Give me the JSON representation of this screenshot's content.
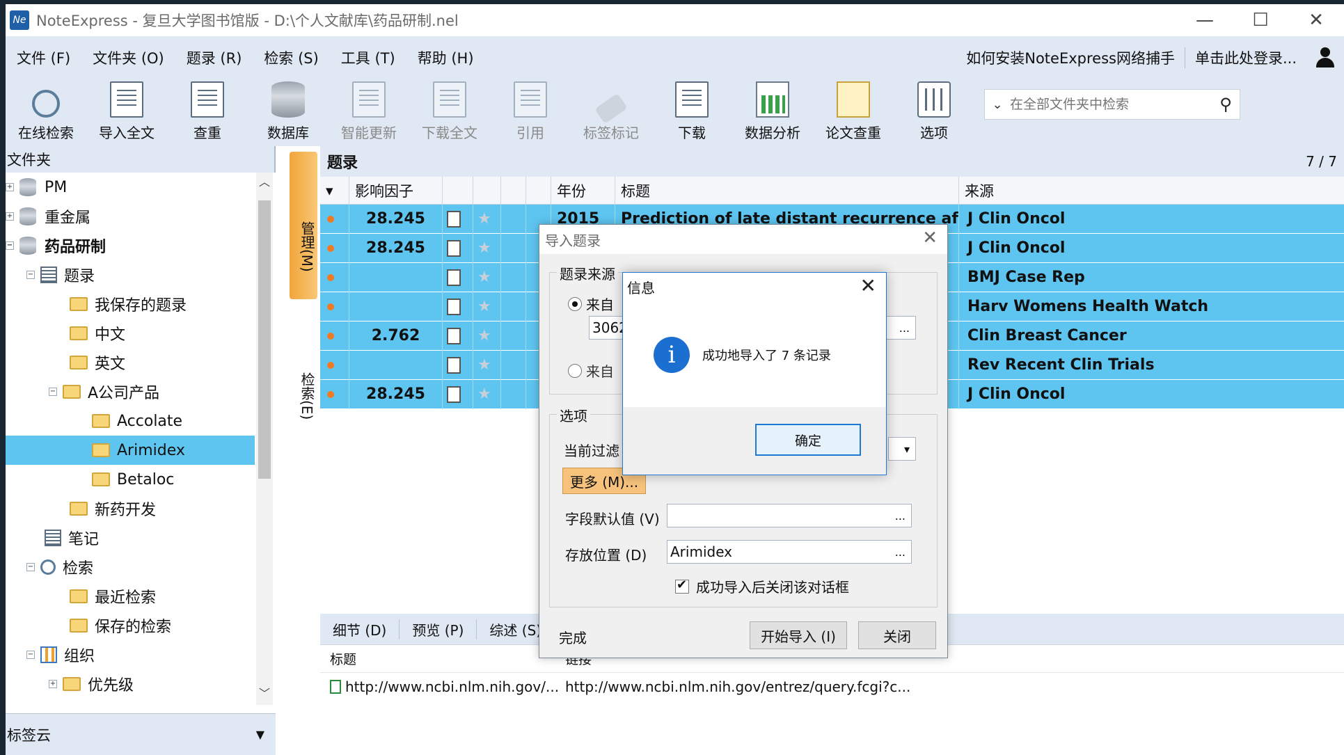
{
  "window": {
    "title": "NoteExpress - 复旦大学图书馆版 - D:\\个人文献库\\药品研制.nel",
    "logo_text": "Ne"
  },
  "menu": {
    "items": [
      "文件 (F)",
      "文件夹 (O)",
      "题录 (R)",
      "检索 (S)",
      "工具 (T)",
      "帮助 (H)"
    ],
    "install_link": "如何安装NoteExpress网络捕手",
    "login_link": "单击此处登录..."
  },
  "toolbar": {
    "tools": [
      {
        "label": "在线检索",
        "icon": "online-search-icon"
      },
      {
        "label": "导入全文",
        "icon": "import-fulltext-icon"
      },
      {
        "label": "查重",
        "icon": "duplicate-check-icon"
      },
      {
        "label": "数据库",
        "icon": "database-icon"
      },
      {
        "label": "智能更新",
        "icon": "smart-update-icon"
      },
      {
        "label": "下载全文",
        "icon": "download-fulltext-icon"
      },
      {
        "label": "引用",
        "icon": "cite-icon"
      },
      {
        "label": "标签标记",
        "icon": "tag-icon"
      },
      {
        "label": "下载",
        "icon": "download-icon"
      },
      {
        "label": "数据分析",
        "icon": "data-analysis-icon"
      },
      {
        "label": "论文查重",
        "icon": "paper-check-icon"
      },
      {
        "label": "选项",
        "icon": "options-icon"
      }
    ],
    "search_placeholder": "在全部文件夹中检索"
  },
  "folders": {
    "header": "文件夹",
    "tree": [
      {
        "label": "PM",
        "level": 0,
        "type": "db"
      },
      {
        "label": "重金属",
        "level": 0,
        "type": "db"
      },
      {
        "label": "药品研制",
        "level": 0,
        "type": "db"
      },
      {
        "label": "题录",
        "level": 1,
        "type": "list"
      },
      {
        "label": "我保存的题录",
        "level": 2,
        "type": "folder"
      },
      {
        "label": "中文",
        "level": 2,
        "type": "folder"
      },
      {
        "label": "英文",
        "level": 2,
        "type": "folder"
      },
      {
        "label": "A公司产品",
        "level": 2,
        "type": "folder"
      },
      {
        "label": "Accolate",
        "level": 3,
        "type": "folder"
      },
      {
        "label": "Arimidex",
        "level": 3,
        "type": "folder",
        "selected": true
      },
      {
        "label": "Betaloc",
        "level": 3,
        "type": "folder"
      },
      {
        "label": "新药开发",
        "level": 2,
        "type": "folder"
      },
      {
        "label": "笔记",
        "level": 1,
        "type": "list"
      },
      {
        "label": "检索",
        "level": 1,
        "type": "search"
      },
      {
        "label": "最近检索",
        "level": 2,
        "type": "folder"
      },
      {
        "label": "保存的检索",
        "level": 2,
        "type": "folder"
      },
      {
        "label": "组织",
        "level": 1,
        "type": "grid"
      },
      {
        "label": "优先级",
        "level": 2,
        "type": "folder"
      }
    ],
    "tag_cloud": "标签云"
  },
  "vertical_tabs": {
    "manage": "管理(M)",
    "search": "检索(E)"
  },
  "records": {
    "header": "题录",
    "count": "7 / 7",
    "columns": [
      "影响因子",
      "年份",
      "标题",
      "来源"
    ],
    "rows": [
      {
        "impact": "28.245",
        "year": "2015",
        "title": "Prediction of late distant recurrence af",
        "source": "J Clin Oncol"
      },
      {
        "impact": "28.245",
        "year": "",
        "title": "",
        "source": "J Clin Oncol"
      },
      {
        "impact": "",
        "year": "",
        "title": "",
        "source": "BMJ Case Rep"
      },
      {
        "impact": "",
        "year": "",
        "title": "",
        "source": "Harv Womens Health Watch"
      },
      {
        "impact": "2.762",
        "year": "",
        "title": "",
        "source": "Clin Breast Cancer"
      },
      {
        "impact": "",
        "year": "",
        "title": "",
        "source": "Rev Recent Clin Trials"
      },
      {
        "impact": "28.245",
        "year": "",
        "title": "",
        "source": "J Clin Oncol"
      }
    ]
  },
  "bottom": {
    "tabs": [
      "细节 (D)",
      "预览 (P)",
      "综述 (S)"
    ],
    "detail_headers": [
      "标题",
      "链接"
    ],
    "detail_values": [
      "http://www.ncbi.nlm.nih.gov/...",
      "http://www.ncbi.nlm.nih.gov/entrez/query.fcgi?c..."
    ]
  },
  "import_dialog": {
    "title": "导入题录",
    "source_group": "题录来源",
    "radio1": "来自",
    "field_value": "3062",
    "radio2": "来自",
    "options_group": "选项",
    "filter_label": "当前过滤",
    "more_button": "更多 (M)...",
    "default_label": "字段默认值 (V)",
    "default_value": "",
    "location_label": "存放位置 (D)",
    "location_value": "Arimidex",
    "close_after": "成功导入后关闭该对话框",
    "status": "完成",
    "start_button": "开始导入 (I)",
    "close_button": "关闭"
  },
  "info_dialog": {
    "title": "信息",
    "message": "成功地导入了 7 条记录",
    "ok": "确定",
    "icon_letter": "i"
  },
  "colors": {
    "accent": "#5ec5f0",
    "toolbar_bg": "#dfe8f3",
    "active_tab": "#f2a53a"
  }
}
